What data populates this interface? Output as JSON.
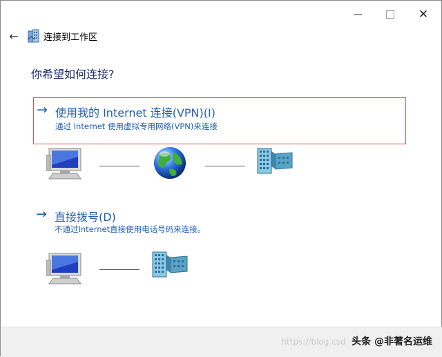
{
  "window": {
    "title": "连接到工作区",
    "caption_minimize": "",
    "caption_maximize": "",
    "caption_close": "✕"
  },
  "nav": {
    "back_glyph": "←"
  },
  "heading": "你希望如何连接?",
  "options": [
    {
      "arrow": "→",
      "title": "使用我的 Internet 连接(VPN)(I)",
      "description": "通过 Internet 使用虚拟专用网络(VPN)来连接",
      "selected": true,
      "border_color": "#d9534f"
    },
    {
      "arrow": "→",
      "title": "直接拨号(D)",
      "description": "不通过Internet直接使用电话号码来连接。",
      "selected": false
    }
  ],
  "icons": {
    "vpn_row": [
      "computer-icon",
      "globe-icon",
      "workplace-building-icon"
    ],
    "dial_row": [
      "computer-icon",
      "workplace-building-icon"
    ]
  },
  "watermark": {
    "url_text": "https://blog.csd",
    "brand_text": "头条 @非著名运维"
  },
  "colors": {
    "link_blue": "#1f5fb4",
    "heading_navy": "#1b2e6a",
    "selection_border": "#d9534f",
    "footer_bg": "#f0f0f0"
  }
}
